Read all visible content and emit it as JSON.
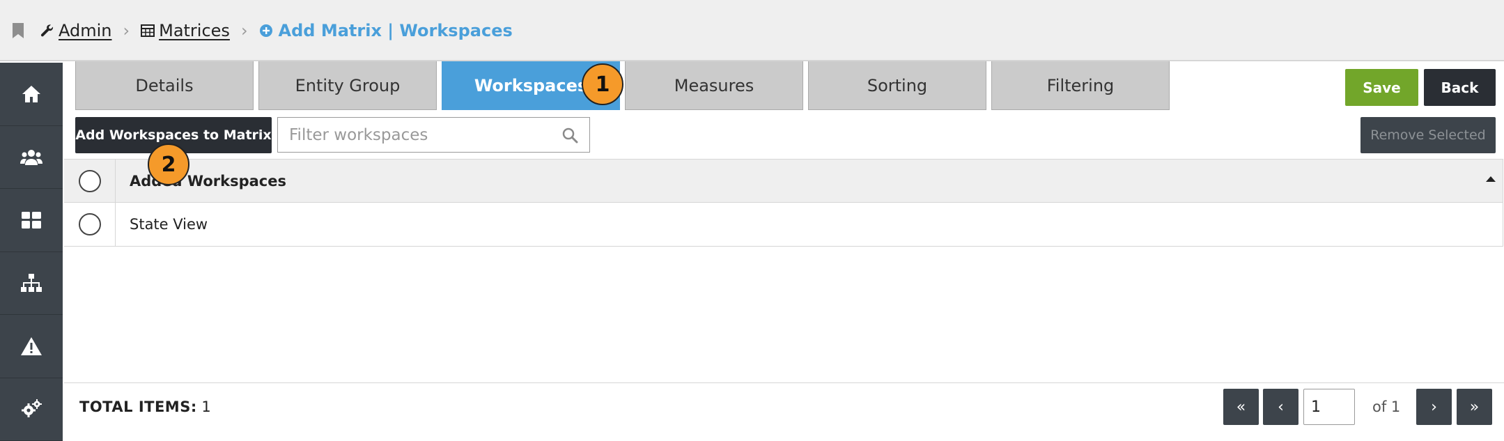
{
  "breadcrumb": {
    "items": [
      {
        "label": "Admin",
        "icon": "wrench-icon"
      },
      {
        "label": "Matrices",
        "icon": "table-icon"
      }
    ],
    "current": "Add Matrix | Workspaces",
    "current_icon": "plus-circle-icon"
  },
  "sidebar": {
    "items": [
      {
        "icon": "home-icon"
      },
      {
        "icon": "users-icon"
      },
      {
        "icon": "dashboard-icon"
      },
      {
        "icon": "hierarchy-icon"
      },
      {
        "icon": "warning-icon"
      },
      {
        "icon": "gears-icon"
      }
    ]
  },
  "tabs": [
    {
      "label": "Details",
      "active": false
    },
    {
      "label": "Entity Group",
      "active": false
    },
    {
      "label": "Workspaces",
      "active": true
    },
    {
      "label": "Measures",
      "active": false
    },
    {
      "label": "Sorting",
      "active": false
    },
    {
      "label": "Filtering",
      "active": false
    }
  ],
  "toolbar": {
    "save_label": "Save",
    "back_label": "Back",
    "add_label": "Add Workspaces to Matrix",
    "remove_label": "Remove Selected",
    "filter_placeholder": "Filter workspaces"
  },
  "table": {
    "header": "Added Workspaces",
    "rows": [
      {
        "label": "State View"
      }
    ]
  },
  "footer": {
    "total_label": "TOTAL ITEMS:",
    "total_value": "1",
    "page_value": "1",
    "of_label": "of 1"
  },
  "callouts": [
    "1",
    "2"
  ],
  "colors": {
    "accent": "#4a9fda",
    "save": "#72a62a",
    "dark": "#2a2e34",
    "sidebar": "#3d444b",
    "callout": "#f59a2a"
  }
}
